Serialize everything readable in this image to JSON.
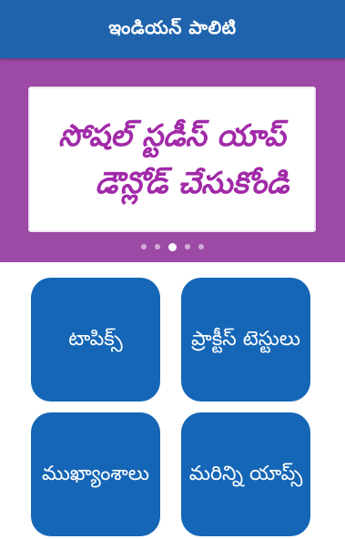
{
  "appbar": {
    "title": "ఇండియన్ పాలిటి"
  },
  "banner": {
    "line1": "సోషల్ స్టడీస్ యాప్",
    "line2": "డౌన్లోడ్ చేసుకోండి",
    "colors": {
      "background": "#9c4aa6",
      "text": "#a12aa8"
    },
    "pager": {
      "count": 5,
      "active_index": 2
    }
  },
  "tiles": [
    {
      "label": "టాపిక్స్"
    },
    {
      "label": "ప్రాక్టీస్ టెస్టులు"
    },
    {
      "label": "ముఖ్యాంశాలు"
    },
    {
      "label": "మరిన్ని యాప్స్"
    }
  ],
  "colors": {
    "primary": "#1f63ad",
    "tile": "#1566b6"
  }
}
